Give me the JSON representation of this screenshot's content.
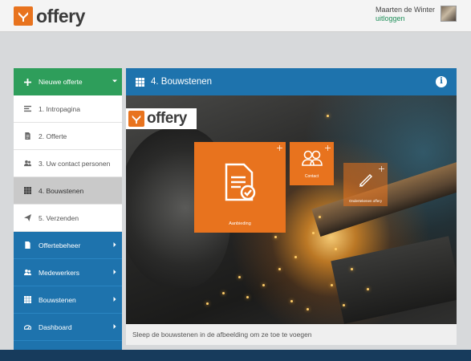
{
  "header": {
    "brand": "offery",
    "user_name": "Maarten de Winter",
    "logout_label": "uitloggen"
  },
  "sidebar": {
    "new_offer": {
      "label": "Nieuwe offerte",
      "icon": "plus-icon"
    },
    "steps": [
      {
        "label": "1. Intropagina",
        "icon": "text-lines-icon"
      },
      {
        "label": "2. Offerte",
        "icon": "document-icon"
      },
      {
        "label": "3. Uw contact personen",
        "icon": "users-icon"
      },
      {
        "label": "4. Bouwstenen",
        "icon": "grid-icon",
        "active": true
      },
      {
        "label": "5. Verzenden",
        "icon": "send-icon"
      }
    ],
    "sections": [
      {
        "label": "Offertebeheer",
        "icon": "file-icon"
      },
      {
        "label": "Medewerkers",
        "icon": "users-icon"
      },
      {
        "label": "Bouwstenen",
        "icon": "grid-icon"
      },
      {
        "label": "Dashboard",
        "icon": "dashboard-icon"
      }
    ]
  },
  "panel": {
    "title": "4. Bouwstenen",
    "scene_brand": "offery",
    "tiles": {
      "main": "Aanbieding",
      "contact": "Contact",
      "signature": "Ondertekenen offery"
    },
    "footer_text": "Sleep de bouwstenen in de afbeelding om ze toe te voegen"
  },
  "colors": {
    "brand_orange": "#e8731e",
    "accent_green": "#2e9e5b",
    "nav_blue": "#1e73ad",
    "logout_green": "#1f8f5a"
  }
}
